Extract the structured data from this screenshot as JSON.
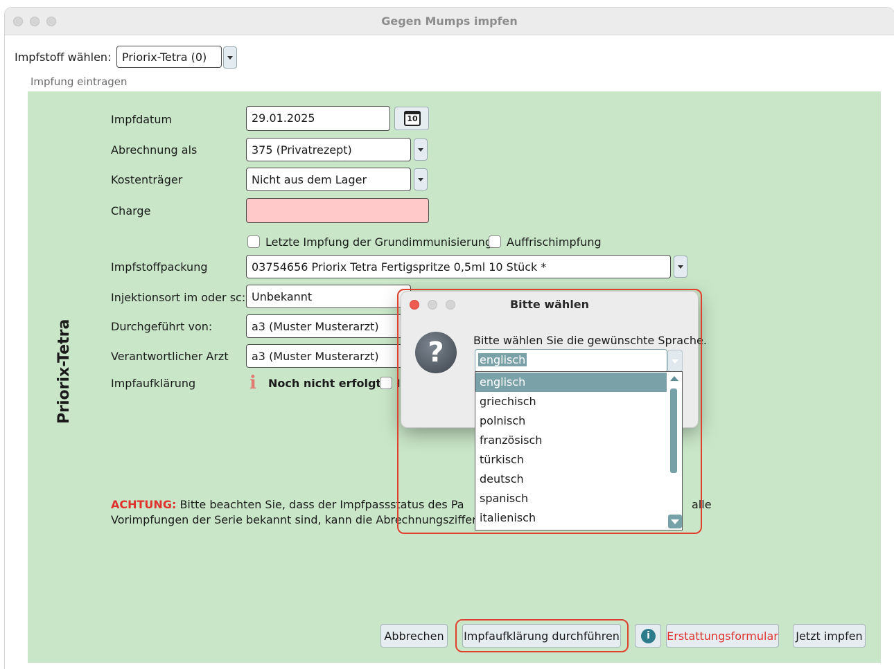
{
  "window": {
    "title": "Gegen Mumps impfen"
  },
  "top": {
    "vaccine_label": "Impfstoff wählen:",
    "vaccine_value": "Priorix-Tetra (0)",
    "section_title": "Impfung eintragen"
  },
  "side_title": "Priorix-Tetra",
  "form": {
    "impfdatum_label": "Impfdatum",
    "impfdatum_value": "29.01.2025",
    "calendar_day": "10",
    "abrechnung_label": "Abrechnung als",
    "abrechnung_value": "375 (Privatrezept)",
    "kostentraeger_label": "Kostenträger",
    "kostentraeger_value": "Nicht aus dem Lager",
    "charge_label": "Charge",
    "charge_value": "",
    "cb_grundimmunisierung": "Letzte Impfung der Grundimmunisierung",
    "cb_auffrischimpfung": "Auffrischimpfung",
    "packung_label": "Impfstoffpackung",
    "packung_value": "03754656 Priorix Tetra Fertigspritze 0,5ml 10 Stück *",
    "injektionsort_label": "Injektionsort im oder sc:",
    "injektionsort_value": "Unbekannt",
    "durchgefuehrt_label": "Durchgeführt von:",
    "durchgefuehrt_value": "a3 (Muster Musterarzt)",
    "arzt_label": "Verantwortlicher Arzt",
    "arzt_value": "a3 (Muster Musterarzt)",
    "aufklaerung_label": "Impfaufklärung",
    "aufklaerung_status": "Noch nicht erfolgt",
    "aufklaerung_cb_partial": "I"
  },
  "warning": {
    "prefix": "ACHTUNG:",
    "line1_left": "Bitte  beachten  Sie,  dass  der  Impfpassstatus  des  Pa",
    "line1_right": "alle",
    "line2": "Vorimpfungen der Serie bekannt sind, kann die Abrechnungsziffer ung"
  },
  "buttons": {
    "cancel": "Abbrechen",
    "aufklaerung": "Impfaufklärung durchführen",
    "erstattung": "Erstattungsformular",
    "impfen": "Jetzt impfen"
  },
  "dialog": {
    "title": "Bitte wählen",
    "message": "Bitte wählen Sie die gewünschte Sprache.",
    "selected": "englisch",
    "options": [
      "englisch",
      "griechisch",
      "polnisch",
      "französisch",
      "türkisch",
      "deutsch",
      "spanisch",
      "italienisch"
    ]
  },
  "colors": {
    "warning": "#e0312d",
    "highlight": "#e0412d",
    "green_panel": "#c9e6c8",
    "charge_field": "#ffc9c9",
    "selection": "#7aa1a8"
  }
}
